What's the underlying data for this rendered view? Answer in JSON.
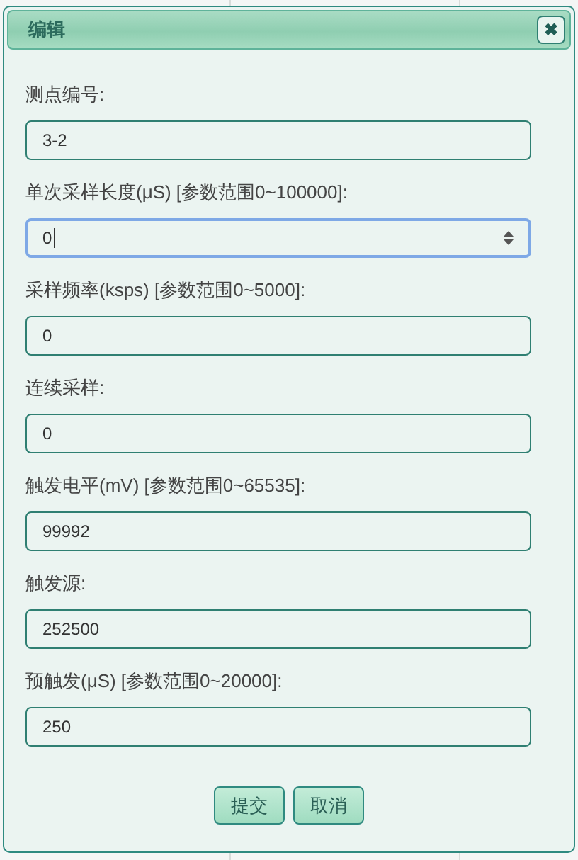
{
  "dialog": {
    "title": "编辑",
    "close_label": "✖"
  },
  "fields": [
    {
      "label": "测点编号:",
      "value": "3-2",
      "kind": "text",
      "focused": false
    },
    {
      "label": "单次采样长度(μS) [参数范围0~100000]:",
      "value": "0",
      "kind": "number",
      "focused": true
    },
    {
      "label": "采样频率(ksps) [参数范围0~5000]:",
      "value": "0",
      "kind": "text",
      "focused": false
    },
    {
      "label": "连续采样:",
      "value": "0",
      "kind": "text",
      "focused": false
    },
    {
      "label": "触发电平(mV) [参数范围0~65535]:",
      "value": "99992",
      "kind": "text",
      "focused": false
    },
    {
      "label": "触发源:",
      "value": "252500",
      "kind": "text",
      "focused": false
    },
    {
      "label": "预触发(μS) [参数范围0~20000]:",
      "value": "250",
      "kind": "text",
      "focused": false
    }
  ],
  "buttons": [
    "提交",
    "取消"
  ]
}
